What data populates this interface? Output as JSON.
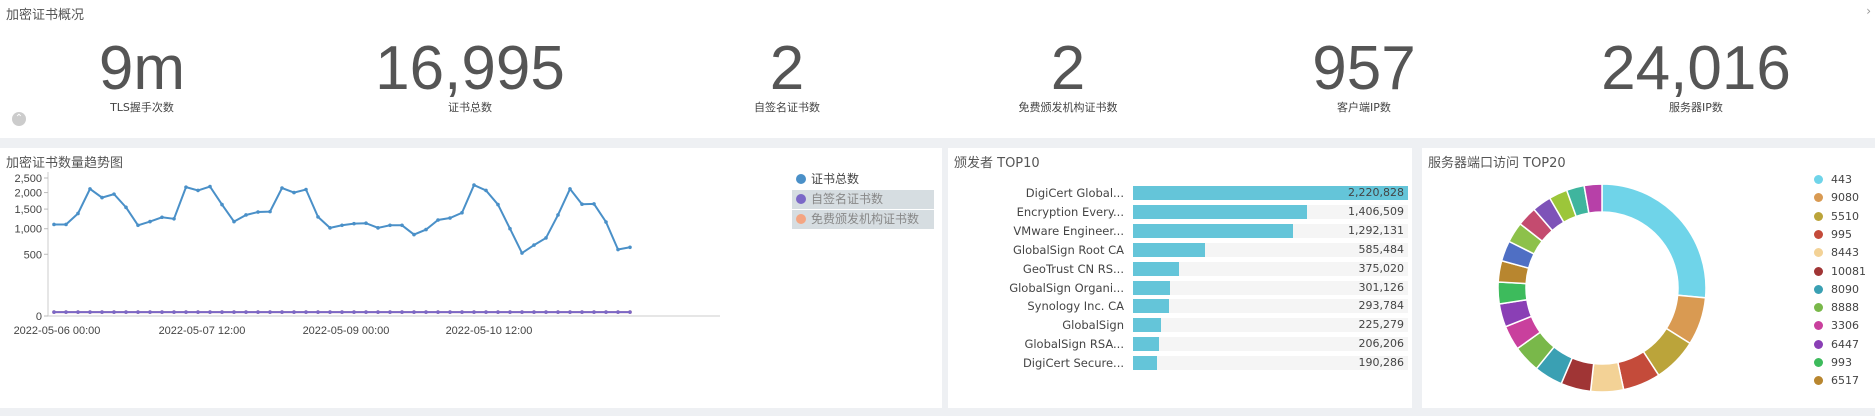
{
  "overview": {
    "title": "加密证书概况",
    "kpis": [
      {
        "value": "9m",
        "label": "TLS握手次数"
      },
      {
        "value": "16,995",
        "label": "证书总数"
      },
      {
        "value": "2",
        "label": "自签名证书数"
      },
      {
        "value": "2",
        "label": "免费颁发机构证书数"
      },
      {
        "value": "957",
        "label": "客户端IP数"
      },
      {
        "value": "24,016",
        "label": "服务器IP数"
      }
    ]
  },
  "trend": {
    "title": "加密证书数量趋势图",
    "legend": [
      {
        "label": "证书总数",
        "color": "#4a90c8",
        "active": true
      },
      {
        "label": "自签名证书数",
        "color": "#7b68c7",
        "active": false
      },
      {
        "label": "免费颁发机构证书数",
        "color": "#f4a582",
        "active": false
      }
    ]
  },
  "issuers": {
    "title": "颁发者 TOP10",
    "items": [
      {
        "name": "DigiCert Global...",
        "value": 2220828,
        "label": "2,220,828"
      },
      {
        "name": "Encryption Every...",
        "value": 1406509,
        "label": "1,406,509"
      },
      {
        "name": "VMware Engineer...",
        "value": 1292131,
        "label": "1,292,131"
      },
      {
        "name": "GlobalSign Root CA",
        "value": 585484,
        "label": "585,484"
      },
      {
        "name": "GeoTrust CN RS...",
        "value": 375020,
        "label": "375,020"
      },
      {
        "name": "GlobalSign Organi...",
        "value": 301126,
        "label": "301,126"
      },
      {
        "name": "Synology Inc. CA",
        "value": 293784,
        "label": "293,784"
      },
      {
        "name": "GlobalSign",
        "value": 225279,
        "label": "225,279"
      },
      {
        "name": "GlobalSign RSA...",
        "value": 206206,
        "label": "206,206"
      },
      {
        "name": "DigiCert Secure...",
        "value": 190286,
        "label": "190,286"
      }
    ]
  },
  "ports": {
    "title": "服务器端口访问 TOP20",
    "legend": [
      {
        "label": "443",
        "color": "#6fd4e9"
      },
      {
        "label": "9080",
        "color": "#d99a52"
      },
      {
        "label": "5510",
        "color": "#bba43a"
      },
      {
        "label": "995",
        "color": "#c44b3a"
      },
      {
        "label": "8443",
        "color": "#f3d296"
      },
      {
        "label": "10081",
        "color": "#a03535"
      },
      {
        "label": "8090",
        "color": "#3aa0b3"
      },
      {
        "label": "8888",
        "color": "#79b84a"
      },
      {
        "label": "3306",
        "color": "#c9409d"
      },
      {
        "label": "6447",
        "color": "#8a3fb5"
      },
      {
        "label": "993",
        "color": "#3dbb5c"
      },
      {
        "label": "6517",
        "color": "#b8862f"
      }
    ]
  },
  "chart_data": [
    {
      "type": "line",
      "title": "加密证书数量趋势图",
      "y_scale": "sqrt",
      "ylim": [
        0,
        2500
      ],
      "yticks": [
        "2,500",
        "2,000",
        "1,500",
        "1,000",
        "500",
        "0"
      ],
      "xticks": [
        "2022-05-06 00:00",
        "2022-05-07 12:00",
        "2022-05-09 00:00",
        "2022-05-10 12:00"
      ],
      "series": [
        {
          "name": "证书总数",
          "color": "#4a90c8",
          "values": [
            1100,
            1100,
            1380,
            2120,
            1840,
            1950,
            1550,
            1080,
            1170,
            1280,
            1240,
            2180,
            2070,
            2200,
            1630,
            1170,
            1340,
            1420,
            1430,
            2150,
            2000,
            2100,
            1290,
            1020,
            1080,
            1120,
            1130,
            1020,
            1080,
            1080,
            870,
            980,
            1210,
            1260,
            1400,
            2250,
            2070,
            1630,
            1000,
            520,
            660,
            800,
            1340,
            2120,
            1640,
            1650,
            1160,
            580,
            620
          ]
        },
        {
          "name": "自签名证书数",
          "color": "#7b68c7",
          "values": [
            2,
            2,
            2,
            2,
            2,
            2,
            2,
            2,
            2,
            2,
            2,
            2,
            2,
            2,
            2,
            2,
            2,
            2,
            2,
            2,
            2,
            2,
            2,
            2,
            2,
            2,
            2,
            2,
            2,
            2,
            2,
            2,
            2,
            2,
            2,
            2,
            2,
            2,
            2,
            2,
            2,
            2,
            2,
            2,
            2,
            2,
            2,
            2,
            2
          ]
        },
        {
          "name": "免费颁发机构证书数",
          "color": "#f4a582",
          "values": [
            2,
            2,
            2,
            2,
            2,
            2,
            2,
            2,
            2,
            2,
            2,
            2,
            2,
            2,
            2,
            2,
            2,
            2,
            2,
            2,
            2,
            2,
            2,
            2,
            2,
            2,
            2,
            2,
            2,
            2,
            2,
            2,
            2,
            2,
            2,
            2,
            2,
            2,
            2,
            2,
            2,
            2,
            2,
            2,
            2,
            2,
            2,
            2,
            2
          ]
        }
      ]
    },
    {
      "type": "bar",
      "title": "颁发者 TOP10",
      "categories": [
        "DigiCert Global...",
        "Encryption Every...",
        "VMware Engineer...",
        "GlobalSign Root CA",
        "GeoTrust CN RS...",
        "GlobalSign Organi...",
        "Synology Inc. CA",
        "GlobalSign",
        "GlobalSign RSA...",
        "DigiCert Secure..."
      ],
      "values": [
        2220828,
        1406509,
        1292131,
        585484,
        375020,
        301126,
        293784,
        225279,
        206206,
        190286
      ]
    },
    {
      "type": "pie",
      "title": "服务器端口访问 TOP20",
      "donut": true,
      "slices": [
        {
          "label": "443",
          "value": 25,
          "color": "#6fd4e9"
        },
        {
          "label": "9080",
          "value": 7,
          "color": "#d99a52"
        },
        {
          "label": "5510",
          "value": 6.5,
          "color": "#bba43a"
        },
        {
          "label": "995",
          "value": 5.5,
          "color": "#c44b3a"
        },
        {
          "label": "8443",
          "value": 4.8,
          "color": "#f3d296"
        },
        {
          "label": "10081",
          "value": 4.4,
          "color": "#a03535"
        },
        {
          "label": "8090",
          "value": 4.2,
          "color": "#3aa0b3"
        },
        {
          "label": "8888",
          "value": 4,
          "color": "#79b84a"
        },
        {
          "label": "3306",
          "value": 3.6,
          "color": "#c9409d"
        },
        {
          "label": "6447",
          "value": 3.4,
          "color": "#8a3fb5"
        },
        {
          "label": "993",
          "value": 3.2,
          "color": "#3dbb5c"
        },
        {
          "label": "6517",
          "value": 3.1,
          "color": "#b8862f"
        },
        {
          "label": "",
          "value": 3.0,
          "color": "#4f6fc4"
        },
        {
          "label": "",
          "value": 3.0,
          "color": "#8dc14a"
        },
        {
          "label": "",
          "value": 2.9,
          "color": "#c44b6f"
        },
        {
          "label": "",
          "value": 2.8,
          "color": "#7e53b8"
        },
        {
          "label": "",
          "value": 2.7,
          "color": "#9cc63a"
        },
        {
          "label": "",
          "value": 2.6,
          "color": "#3fb59e"
        },
        {
          "label": "",
          "value": 2.6,
          "color": "#b740a8"
        }
      ]
    }
  ]
}
